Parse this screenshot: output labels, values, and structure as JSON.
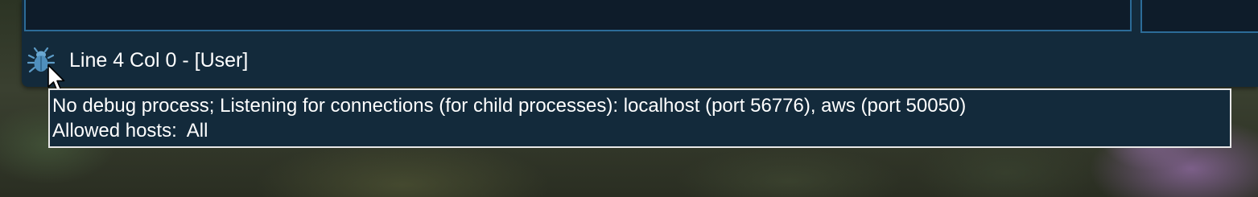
{
  "status_bar": {
    "debug_icon": "bug-icon",
    "position_text": "Line 4 Col 0 - [User]"
  },
  "tooltip": {
    "line1": "No debug process; Listening for connections (for child processes): localhost (port 56776), aws (port 50050)",
    "line2": "Allowed hosts:  All"
  },
  "colors": {
    "panel_bg": "#132a3b",
    "editor_bg": "#0e1c2a",
    "pane_border": "#2c6c98",
    "tooltip_border": "#e8e8e8",
    "text": "#ffffff"
  }
}
